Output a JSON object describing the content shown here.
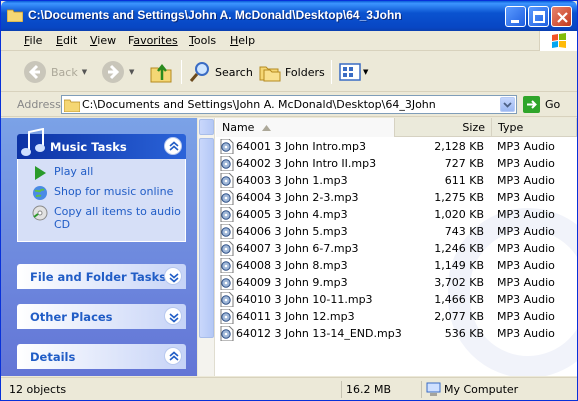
{
  "window": {
    "title": "C:\\Documents and Settings\\John A. McDonald\\Desktop\\64_3John"
  },
  "menu": [
    {
      "key": "F",
      "rest": "ile"
    },
    {
      "key": "E",
      "rest": "dit"
    },
    {
      "key": "V",
      "rest": "iew"
    },
    {
      "key": "",
      "rest": "Favorites",
      "first": "F",
      "tail": "avorites"
    },
    {
      "key": "T",
      "rest": "ools"
    },
    {
      "key": "H",
      "rest": "elp"
    }
  ],
  "toolbar": {
    "back": "Back",
    "search": "Search",
    "folders": "Folders"
  },
  "address": {
    "label": "Address",
    "value": "C:\\Documents and Settings\\John A. McDonald\\Desktop\\64_3John",
    "go": "Go"
  },
  "taskpane": {
    "music": {
      "title": "Music Tasks",
      "tasks": [
        "Play all",
        "Shop for music online",
        "Copy all items to audio CD"
      ]
    },
    "file_folder": {
      "title": "File and Folder Tasks"
    },
    "other": {
      "title": "Other Places"
    },
    "details": {
      "title": "Details"
    }
  },
  "list": {
    "columns": {
      "name": "Name",
      "size": "Size",
      "type": "Type"
    },
    "files": [
      {
        "name": "64001 3 John Intro.mp3",
        "size": "2,128 KB",
        "type": "MP3 Audio"
      },
      {
        "name": "64002 3 John Intro II.mp3",
        "size": "727 KB",
        "type": "MP3 Audio"
      },
      {
        "name": "64003 3 John 1.mp3",
        "size": "611 KB",
        "type": "MP3 Audio"
      },
      {
        "name": "64004 3 John 2-3.mp3",
        "size": "1,275 KB",
        "type": "MP3 Audio"
      },
      {
        "name": "64005 3 John 4.mp3",
        "size": "1,020 KB",
        "type": "MP3 Audio"
      },
      {
        "name": "64006 3 John 5.mp3",
        "size": "743 KB",
        "type": "MP3 Audio"
      },
      {
        "name": "64007 3 John 6-7.mp3",
        "size": "1,246 KB",
        "type": "MP3 Audio"
      },
      {
        "name": "64008 3 John 8.mp3",
        "size": "1,149 KB",
        "type": "MP3 Audio"
      },
      {
        "name": "64009 3 John 9.mp3",
        "size": "3,702 KB",
        "type": "MP3 Audio"
      },
      {
        "name": "64010 3 John 10-11.mp3",
        "size": "1,466 KB",
        "type": "MP3 Audio"
      },
      {
        "name": "64011 3 John 12.mp3",
        "size": "2,077 KB",
        "type": "MP3 Audio"
      },
      {
        "name": "64012 3 John 13-14_END.mp3",
        "size": "536 KB",
        "type": "MP3 Audio"
      }
    ]
  },
  "status": {
    "objects": "12 objects",
    "size": "16.2 MB",
    "location": "My Computer"
  }
}
